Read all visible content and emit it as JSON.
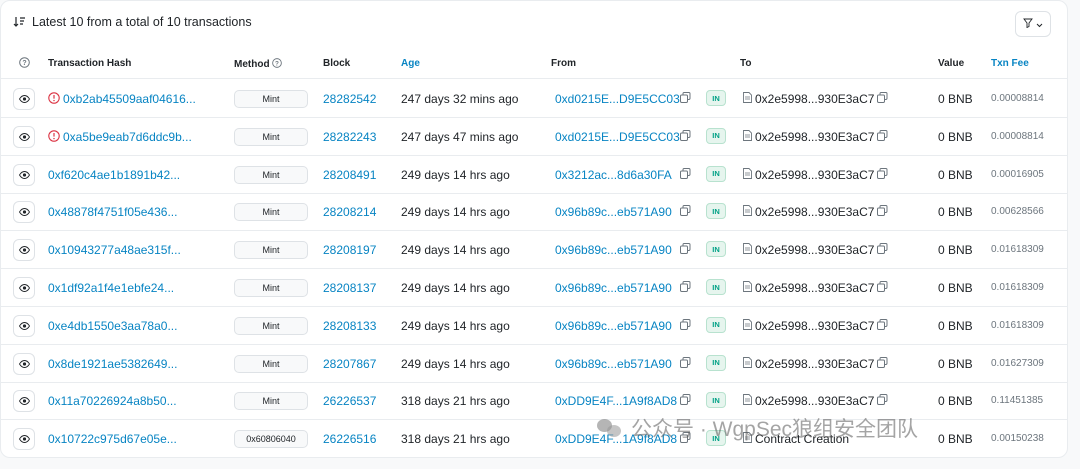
{
  "summary": {
    "text": "Latest 10 from a total of 10 transactions"
  },
  "columns": {
    "help": "?",
    "hash": "Transaction Hash",
    "method": "Method",
    "block": "Block",
    "age": "Age",
    "from": "From",
    "to": "To",
    "value": "Value",
    "fee": "Txn Fee"
  },
  "rows": [
    {
      "hash": "0xb2ab45509aaf04616...",
      "error": true,
      "method": "Mint",
      "block": "28282542",
      "age": "247 days 32 mins ago",
      "from": "0xd0215E...D9E5CC03",
      "dir": "IN",
      "to": "0x2e5998...930E3aC7",
      "value": "0 BNB",
      "fee": "0.00008814"
    },
    {
      "hash": "0xa5be9eab7d6ddc9b...",
      "error": true,
      "method": "Mint",
      "block": "28282243",
      "age": "247 days 47 mins ago",
      "from": "0xd0215E...D9E5CC03",
      "dir": "IN",
      "to": "0x2e5998...930E3aC7",
      "value": "0 BNB",
      "fee": "0.00008814"
    },
    {
      "hash": "0xf620c4ae1b1891b42...",
      "error": false,
      "method": "Mint",
      "block": "28208491",
      "age": "249 days 14 hrs ago",
      "from": "0x3212ac...8d6a30FA",
      "dir": "IN",
      "to": "0x2e5998...930E3aC7",
      "value": "0 BNB",
      "fee": "0.00016905"
    },
    {
      "hash": "0x48878f4751f05e436...",
      "error": false,
      "method": "Mint",
      "block": "28208214",
      "age": "249 days 14 hrs ago",
      "from": "0x96b89c...eb571A90",
      "dir": "IN",
      "to": "0x2e5998...930E3aC7",
      "value": "0 BNB",
      "fee": "0.00628566"
    },
    {
      "hash": "0x10943277a48ae315f...",
      "error": false,
      "method": "Mint",
      "block": "28208197",
      "age": "249 days 14 hrs ago",
      "from": "0x96b89c...eb571A90",
      "dir": "IN",
      "to": "0x2e5998...930E3aC7",
      "value": "0 BNB",
      "fee": "0.01618309"
    },
    {
      "hash": "0x1df92a1f4e1ebfe24...",
      "error": false,
      "method": "Mint",
      "block": "28208137",
      "age": "249 days 14 hrs ago",
      "from": "0x96b89c...eb571A90",
      "dir": "IN",
      "to": "0x2e5998...930E3aC7",
      "value": "0 BNB",
      "fee": "0.01618309"
    },
    {
      "hash": "0xe4db1550e3aa78a0...",
      "error": false,
      "method": "Mint",
      "block": "28208133",
      "age": "249 days 14 hrs ago",
      "from": "0x96b89c...eb571A90",
      "dir": "IN",
      "to": "0x2e5998...930E3aC7",
      "value": "0 BNB",
      "fee": "0.01618309"
    },
    {
      "hash": "0x8de1921ae5382649...",
      "error": false,
      "method": "Mint",
      "block": "28207867",
      "age": "249 days 14 hrs ago",
      "from": "0x96b89c...eb571A90",
      "dir": "IN",
      "to": "0x2e5998...930E3aC7",
      "value": "0 BNB",
      "fee": "0.01627309"
    },
    {
      "hash": "0x11a70226924a8b50...",
      "error": false,
      "method": "Mint",
      "block": "26226537",
      "age": "318 days 21 hrs ago",
      "from": "0xDD9E4F...1A9f8AD8",
      "dir": "IN",
      "to": "0x2e5998...930E3aC7",
      "value": "0 BNB",
      "fee": "0.11451385"
    },
    {
      "hash": "0x10722c975d67e05e...",
      "error": false,
      "method": "0x60806040",
      "block": "26226516",
      "age": "318 days 21 hrs ago",
      "from": "0xDD9E4F...1A9f8AD8",
      "dir": "IN",
      "to": "Contract Creation",
      "value": "0 BNB",
      "fee": "0.00150238"
    }
  ],
  "watermark": {
    "text": "公众号 · WgpSec狼组安全团队"
  },
  "colors": {
    "link": "#0784c3",
    "error": "#dc3545",
    "in_badge": "#00a186"
  },
  "icons": [
    "sort-desc-icon",
    "filter-icon",
    "chevron-down-icon",
    "help-circle-icon",
    "eye-icon",
    "error-circle-icon",
    "copy-icon",
    "document-icon",
    "contract-icon"
  ]
}
